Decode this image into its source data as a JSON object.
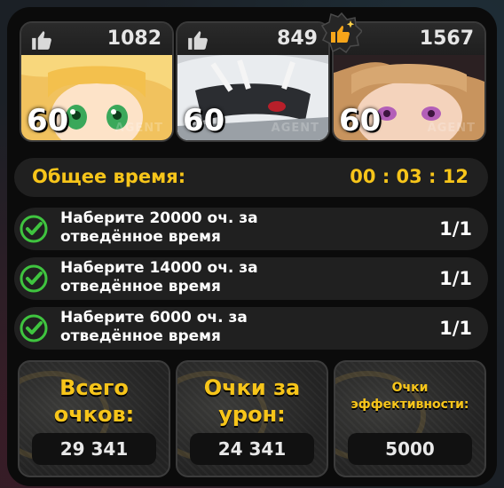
{
  "agents": [
    {
      "likes": "1082",
      "level": "60",
      "tag": "AGENT",
      "mvp": false
    },
    {
      "likes": "849",
      "level": "60",
      "tag": "AGENT",
      "mvp": false
    },
    {
      "likes": "1567",
      "level": "60",
      "tag": "AGENT",
      "mvp": true
    }
  ],
  "total_time": {
    "label": "Общее время:",
    "value": "00 : 03 : 12"
  },
  "tasks": [
    {
      "text": "Наберите 20000 оч. за отведённое время",
      "progress": "1/1"
    },
    {
      "text": "Наберите 14000 оч. за отведённое время",
      "progress": "1/1"
    },
    {
      "text": "Наберите 6000 оч. за отведённое время",
      "progress": "1/1"
    }
  ],
  "scores": [
    {
      "title": "Всего очков:",
      "value": "29 341"
    },
    {
      "title": "Очки за урон:",
      "value": "24 341"
    },
    {
      "title": "Очки эффективности:",
      "value": "5000"
    }
  ],
  "colors": {
    "accent": "#f7c51a",
    "check": "#3fc43f",
    "mvp_badge": "#f7a51a"
  }
}
